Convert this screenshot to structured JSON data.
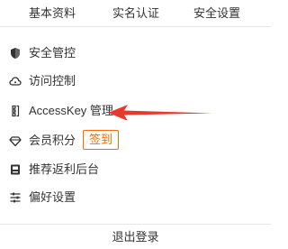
{
  "tabs": [
    {
      "label": "基本资料"
    },
    {
      "label": "实名认证"
    },
    {
      "label": "安全设置"
    }
  ],
  "menu": {
    "items": [
      {
        "label": "安全管控",
        "icon": "shield-icon"
      },
      {
        "label": "访问控制",
        "icon": "cloud-icon"
      },
      {
        "label": "AccessKey 管理",
        "icon": "accesskey-icon"
      },
      {
        "label": "会员积分",
        "icon": "diamond-icon",
        "badge": "签到"
      },
      {
        "label": "推荐返利后台",
        "icon": "rebate-icon"
      },
      {
        "label": "偏好设置",
        "icon": "sliders-icon"
      }
    ]
  },
  "footer": {
    "logout_label": "退出登录"
  },
  "colors": {
    "accent": "#ff6a00",
    "arrow": "#e8392f",
    "text": "#333333",
    "divider": "#e6e6e6"
  }
}
